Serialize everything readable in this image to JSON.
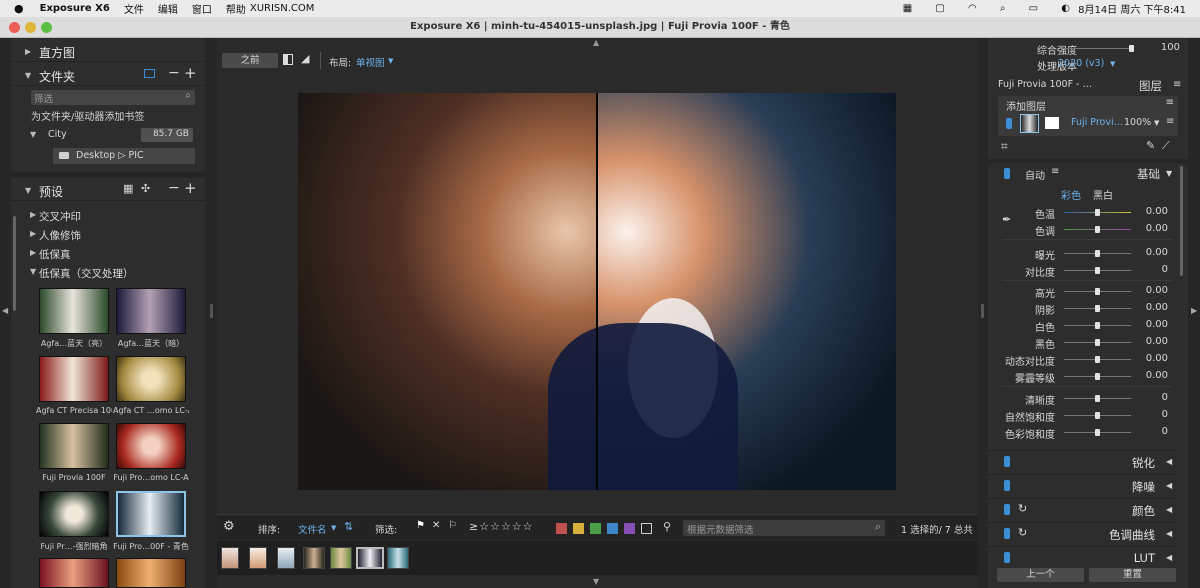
{
  "menubar": {
    "app": "Exposure X6",
    "items": [
      "文件",
      "编辑",
      "窗口",
      "帮助"
    ],
    "url": "XURISN.COM",
    "date": "8月14日 周六 下午8:41"
  },
  "window": {
    "title": "Exposure X6 | minh-tu-454015-unsplash.jpg | Fuji Provia 100F - 青色"
  },
  "left": {
    "histogram": "直方图",
    "folders": {
      "title": "文件夹",
      "filter_placeholder": "筛选",
      "bookmark_hint": "为文件夹/驱动器添加书签",
      "drive": "City",
      "drive_size": "85.7 GB",
      "path": "Desktop ▷ PIC"
    },
    "presets": {
      "title": "预设",
      "groups": [
        "交叉冲印",
        "人像修饰",
        "低保真",
        "低保真（交叉处理）"
      ],
      "thumbs": [
        "Agfa…蓝天（亮）",
        "Agfa…蓝天（暗）",
        "Agfa CT Precisa 100",
        "Agfa CT …omo LC-A",
        "Fuji Provia 100F",
        "Fuji Pro…omo LC-A",
        "Fuji Pr…-强烈暗角",
        "Fuji Pro…00F - 青色"
      ]
    }
  },
  "center": {
    "before_label": "之前",
    "layout_label": "布局:",
    "layout_value": "单视图",
    "sort_label": "排序:",
    "sort_value": "文件名",
    "filter_label": "筛选:",
    "metadata_placeholder": "根据元数据筛选",
    "selection_status": "1 选择的/ 7 总共",
    "stars": "≥☆☆☆☆☆",
    "colors": [
      "#c0504d",
      "#d6b03c",
      "#4a9e4a",
      "#3d86c8",
      "#8450b8"
    ]
  },
  "right": {
    "overall_strength": {
      "label": "综合强度",
      "value": "100",
      "fraction": 0.98
    },
    "process_version": {
      "label": "处理版本",
      "value": "2020 (v3)"
    },
    "preset_name": "Fuji Provia 100F - …",
    "layers": {
      "title": "图层",
      "add": "添加图层",
      "layer_name": "Fuji Provi…",
      "opacity": "100%"
    },
    "basic": {
      "auto": "自动",
      "title": "基础",
      "color_tab": "彩色",
      "bw_tab": "黑白",
      "sliders": [
        {
          "label": "色温",
          "value": "0.00"
        },
        {
          "label": "色调",
          "value": "0.00"
        },
        {
          "label": "曝光",
          "value": "0.00"
        },
        {
          "label": "对比度",
          "value": "0"
        },
        {
          "label": "高光",
          "value": "0.00"
        },
        {
          "label": "阴影",
          "value": "0.00"
        },
        {
          "label": "白色",
          "value": "0.00"
        },
        {
          "label": "黑色",
          "value": "0.00"
        },
        {
          "label": "动态对比度",
          "value": "0.00"
        },
        {
          "label": "雾霾等级",
          "value": "0.00"
        },
        {
          "label": "清晰度",
          "value": "0"
        },
        {
          "label": "自然饱和度",
          "value": "0"
        },
        {
          "label": "色彩饱和度",
          "value": "0"
        }
      ]
    },
    "sections": [
      "锐化",
      "降噪",
      "颜色",
      "色调曲线",
      "LUT"
    ],
    "prev_button": "上一个",
    "reset_button": "重置"
  }
}
